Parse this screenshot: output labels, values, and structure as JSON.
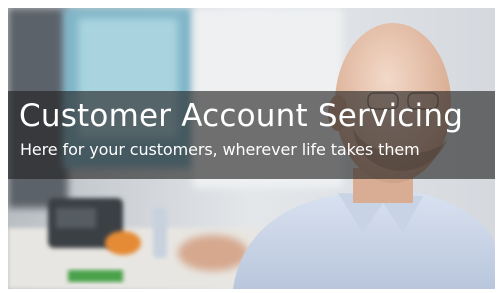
{
  "hero": {
    "title": "Customer Account Servicing",
    "subtitle": "Here for your customers, wherever life takes them",
    "image_icon": "photo-of-smiling-man-in-office",
    "banner_color": "#202020"
  }
}
